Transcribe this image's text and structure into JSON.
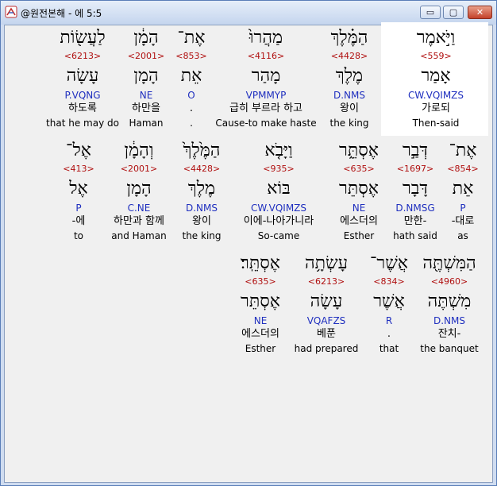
{
  "window": {
    "title": "@원전본해 - 에 5:5",
    "min_glyph": "▭",
    "max_glyph": "▢",
    "close_glyph": "✕"
  },
  "words": [
    {
      "heb": "וַיֹּ֣אמֶר",
      "num": "<559>",
      "lex": "אָמַר",
      "parse": "CW.VQIMZS",
      "kor": "가로되",
      "eng": "Then-said"
    },
    {
      "heb": "הַמֶּ֗לֶךְ",
      "num": "<4428>",
      "lex": "מֶלֶךְ",
      "parse": "D.NMS",
      "kor": "왕이",
      "eng": "the king"
    },
    {
      "heb": "מַהֲרוּ֙",
      "num": "<4116>",
      "lex": "מָהַר",
      "parse": "VPMMYP",
      "kor": "급히 부르라 하고",
      "eng": "Cause-to make haste"
    },
    {
      "heb": "אֶת־",
      "num": "<853>",
      "lex": "אֵת",
      "parse": "O",
      "kor": ".",
      "eng": "."
    },
    {
      "heb": "הָמָ֔ן",
      "num": "<2001>",
      "lex": "הָמָן",
      "parse": "NE",
      "kor": "하만을",
      "eng": "Haman"
    },
    {
      "heb": "לַעֲשׂ֖וֹת",
      "num": "<6213>",
      "lex": "עָשָׂה",
      "parse": "P.VQNG",
      "kor": "하도록",
      "eng": "that he may do"
    },
    {
      "heb": "אֶת־",
      "num": "<854>",
      "lex": "אֵת",
      "parse": "P",
      "kor": "-대로",
      "eng": "as"
    },
    {
      "heb": "דְּבַ֣ר",
      "num": "<1697>",
      "lex": "דָּבָר",
      "parse": "D.NMSG",
      "kor": "만한-",
      "eng": "hath said"
    },
    {
      "heb": "אֶסְתֵּ֑ר",
      "num": "<635>",
      "lex": "אֶסְתֵּר",
      "parse": "NE",
      "kor": "에스더의",
      "eng": "Esther"
    },
    {
      "heb": "וַיָּבֹ֤א",
      "num": "<935>",
      "lex": "בּוֹא",
      "parse": "CW.VQIMZS",
      "kor": "이에-나아가니라",
      "eng": "So-came"
    },
    {
      "heb": "הַמֶּ֙לֶךְ֙",
      "num": "<4428>",
      "lex": "מֶלֶךְ",
      "parse": "D.NMS",
      "kor": "왕이",
      "eng": "the king"
    },
    {
      "heb": "וְהָמָ֔ן",
      "num": "<2001>",
      "lex": "הָמָן",
      "parse": "C.NE",
      "kor": "하만과 함께",
      "eng": "and Haman"
    },
    {
      "heb": "אֶל־",
      "num": "<413>",
      "lex": "אֶל",
      "parse": "P",
      "kor": "-에",
      "eng": "to"
    },
    {
      "heb": "הַמִּשְׁתֶּ֖ה",
      "num": "<4960>",
      "lex": "מִשְׁתֶּה",
      "parse": "D.NMS",
      "kor": "잔치-",
      "eng": "the banquet"
    },
    {
      "heb": "אֲשֶׁר־",
      "num": "<834>",
      "lex": "אֲשֶׁר",
      "parse": "R",
      "kor": ".",
      "eng": "that"
    },
    {
      "heb": "עָשְׂתָ֥ה",
      "num": "<6213>",
      "lex": "עָשָׂה",
      "parse": "VQAFZS",
      "kor": "베푼",
      "eng": "had prepared"
    },
    {
      "heb": "אֶסְתֵּֽר׃",
      "num": "<635>",
      "lex": "אֶסְתֵּר",
      "parse": "NE",
      "kor": "에스더의",
      "eng": "Esther"
    }
  ]
}
